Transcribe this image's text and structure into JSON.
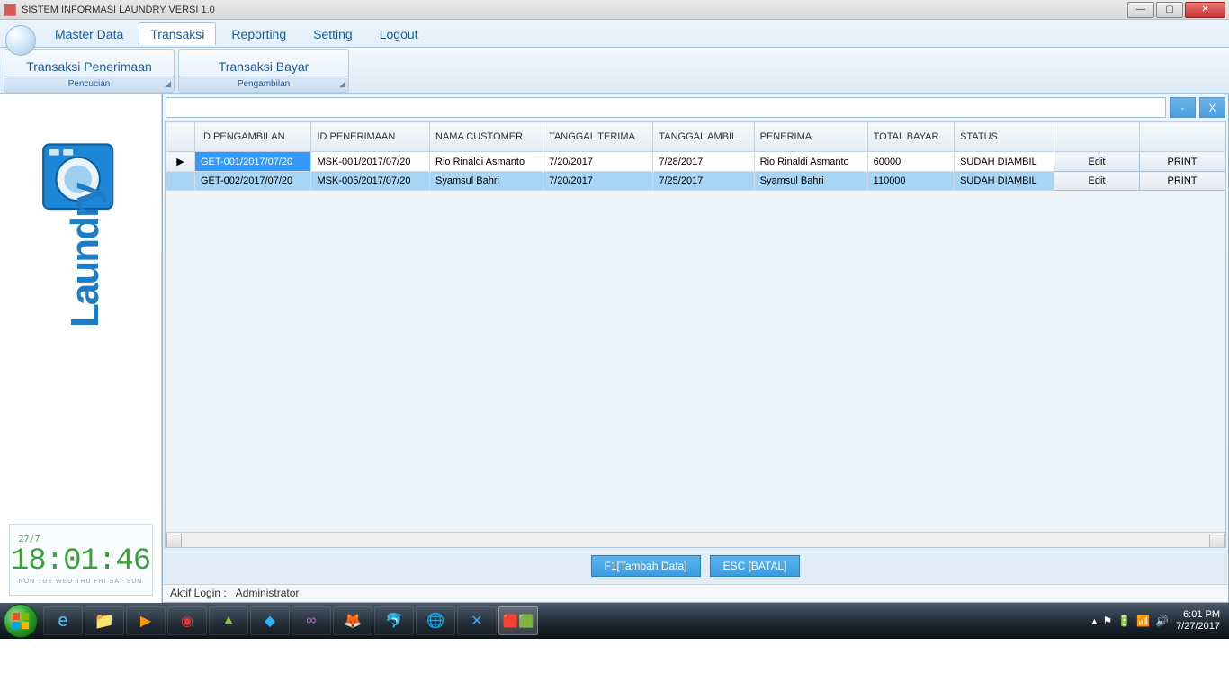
{
  "window": {
    "title": "SISTEM INFORMASI LAUNDRY  VERSI 1.0"
  },
  "ribbon": {
    "tabs": [
      "Master Data",
      "Transaksi",
      "Reporting",
      "Setting",
      "Logout"
    ],
    "active_tab": "Transaksi",
    "groups": [
      {
        "button": "Transaksi Penerimaan",
        "footer": "Pencucian"
      },
      {
        "button": "Transaksi Bayar",
        "footer": "Pengambilan"
      }
    ]
  },
  "search": {
    "value": "",
    "minus": "-",
    "close": "X"
  },
  "grid": {
    "headers": [
      "",
      "ID PENGAMBILAN",
      "ID PENERIMAAN",
      "NAMA CUSTOMER",
      "TANGGAL TERIMA",
      "TANGGAL AMBIL",
      "PENERIMA",
      "TOTAL BAYAR",
      "STATUS",
      "",
      ""
    ],
    "rows": [
      {
        "marker": "▶",
        "id_pengambilan": "GET-001/2017/07/20",
        "id_penerimaan": "MSK-001/2017/07/20",
        "nama": "Rio Rinaldi Asmanto",
        "tgl_terima": "7/20/2017",
        "tgl_ambil": "7/28/2017",
        "penerima": "Rio Rinaldi Asmanto",
        "total": "60000",
        "status": "SUDAH DIAMBIL",
        "edit": "Edit",
        "print": "PRINT"
      },
      {
        "marker": "",
        "id_pengambilan": "GET-002/2017/07/20",
        "id_penerimaan": "MSK-005/2017/07/20",
        "nama": "Syamsul Bahri",
        "tgl_terima": "7/20/2017",
        "tgl_ambil": "7/25/2017",
        "penerima": "Syamsul Bahri",
        "total": "110000",
        "status": "SUDAH DIAMBIL",
        "edit": "Edit",
        "print": "PRINT"
      }
    ]
  },
  "actions": {
    "add": "F1[Tambah Data]",
    "cancel": "ESC [BATAL]"
  },
  "status": {
    "label": "Aktif Login :",
    "user": "Administrator"
  },
  "sidebar": {
    "clock_date": "27/7",
    "clock_time": "18:01:46",
    "clock_days": "NON TUE WED THU FRI SAT SUN"
  },
  "taskbar": {
    "time": "6:01 PM",
    "date": "7/27/2017"
  }
}
